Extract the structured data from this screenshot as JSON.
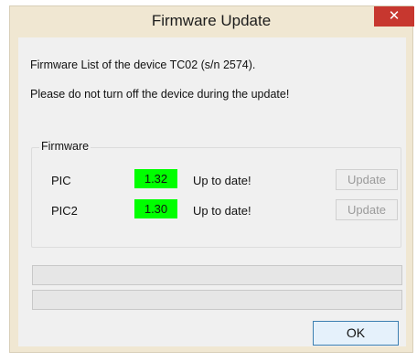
{
  "window": {
    "title": "Firmware Update",
    "close_glyph": "✕"
  },
  "message": {
    "line1": "Firmware List of the device TC02 (s/n 2574).",
    "line2": "Please do not turn off the device during the update!"
  },
  "firmware": {
    "group_label": "Firmware",
    "items": [
      {
        "name": "PIC",
        "version": "1.32",
        "status": "Up to date!",
        "button_label": "Update"
      },
      {
        "name": "PIC2",
        "version": "1.30",
        "status": "Up to date!",
        "button_label": "Update"
      }
    ]
  },
  "progress": {
    "bar1_value": 0,
    "bar2_value": 0
  },
  "buttons": {
    "ok_label": "OK"
  },
  "colors": {
    "version_ok_bg": "#00ff00",
    "close_button_bg": "#c7372f"
  },
  "icons": {
    "close": "close-icon"
  }
}
